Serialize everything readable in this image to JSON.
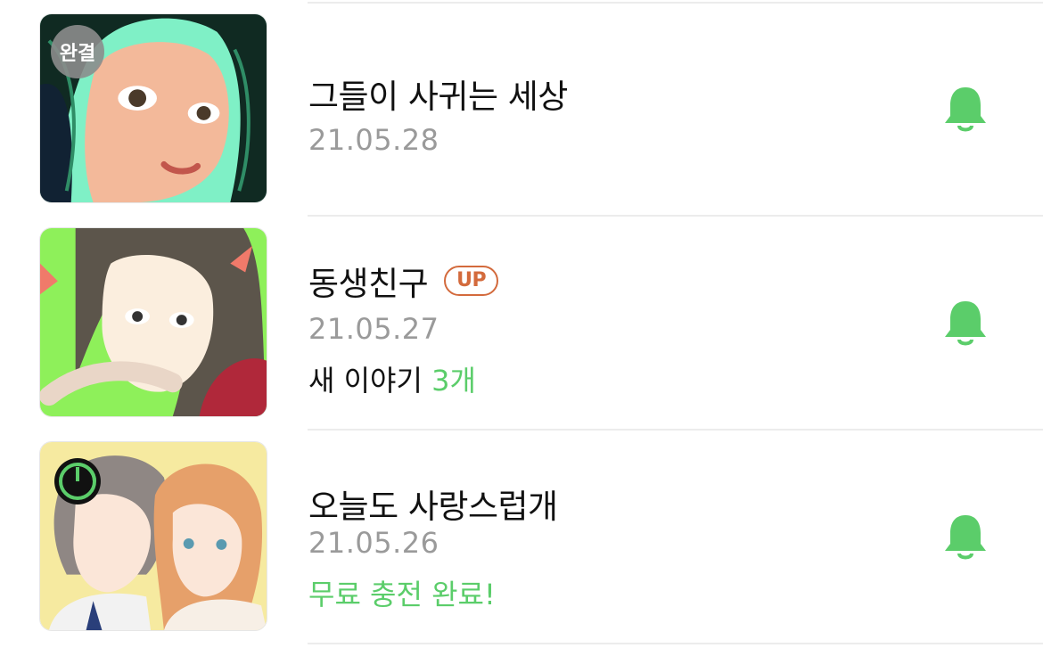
{
  "items": [
    {
      "title": "그들이 사귀는 세상",
      "date": "21.05.28",
      "badge_completed": "완결",
      "colors": {
        "thumb_bg": "#7ff0c6"
      }
    },
    {
      "title": "동생친구",
      "badge_up": "UP",
      "date": "21.05.27",
      "extra_prefix": "새 이야기 ",
      "extra_count": "3개",
      "colors": {
        "thumb_bg": "#8ef05a"
      }
    },
    {
      "title": "오늘도 사랑스럽개",
      "date": "21.05.26",
      "extra_status": "무료 충전 완료!",
      "colors": {
        "thumb_bg": "#f6eaa0"
      }
    }
  ],
  "icons": {
    "bell": "bell-icon",
    "timer": "wait-free-timer-icon"
  },
  "colors": {
    "accent_green": "#5bcd6a",
    "up_badge": "#d36a3c",
    "date_gray": "#9a9a9a"
  }
}
